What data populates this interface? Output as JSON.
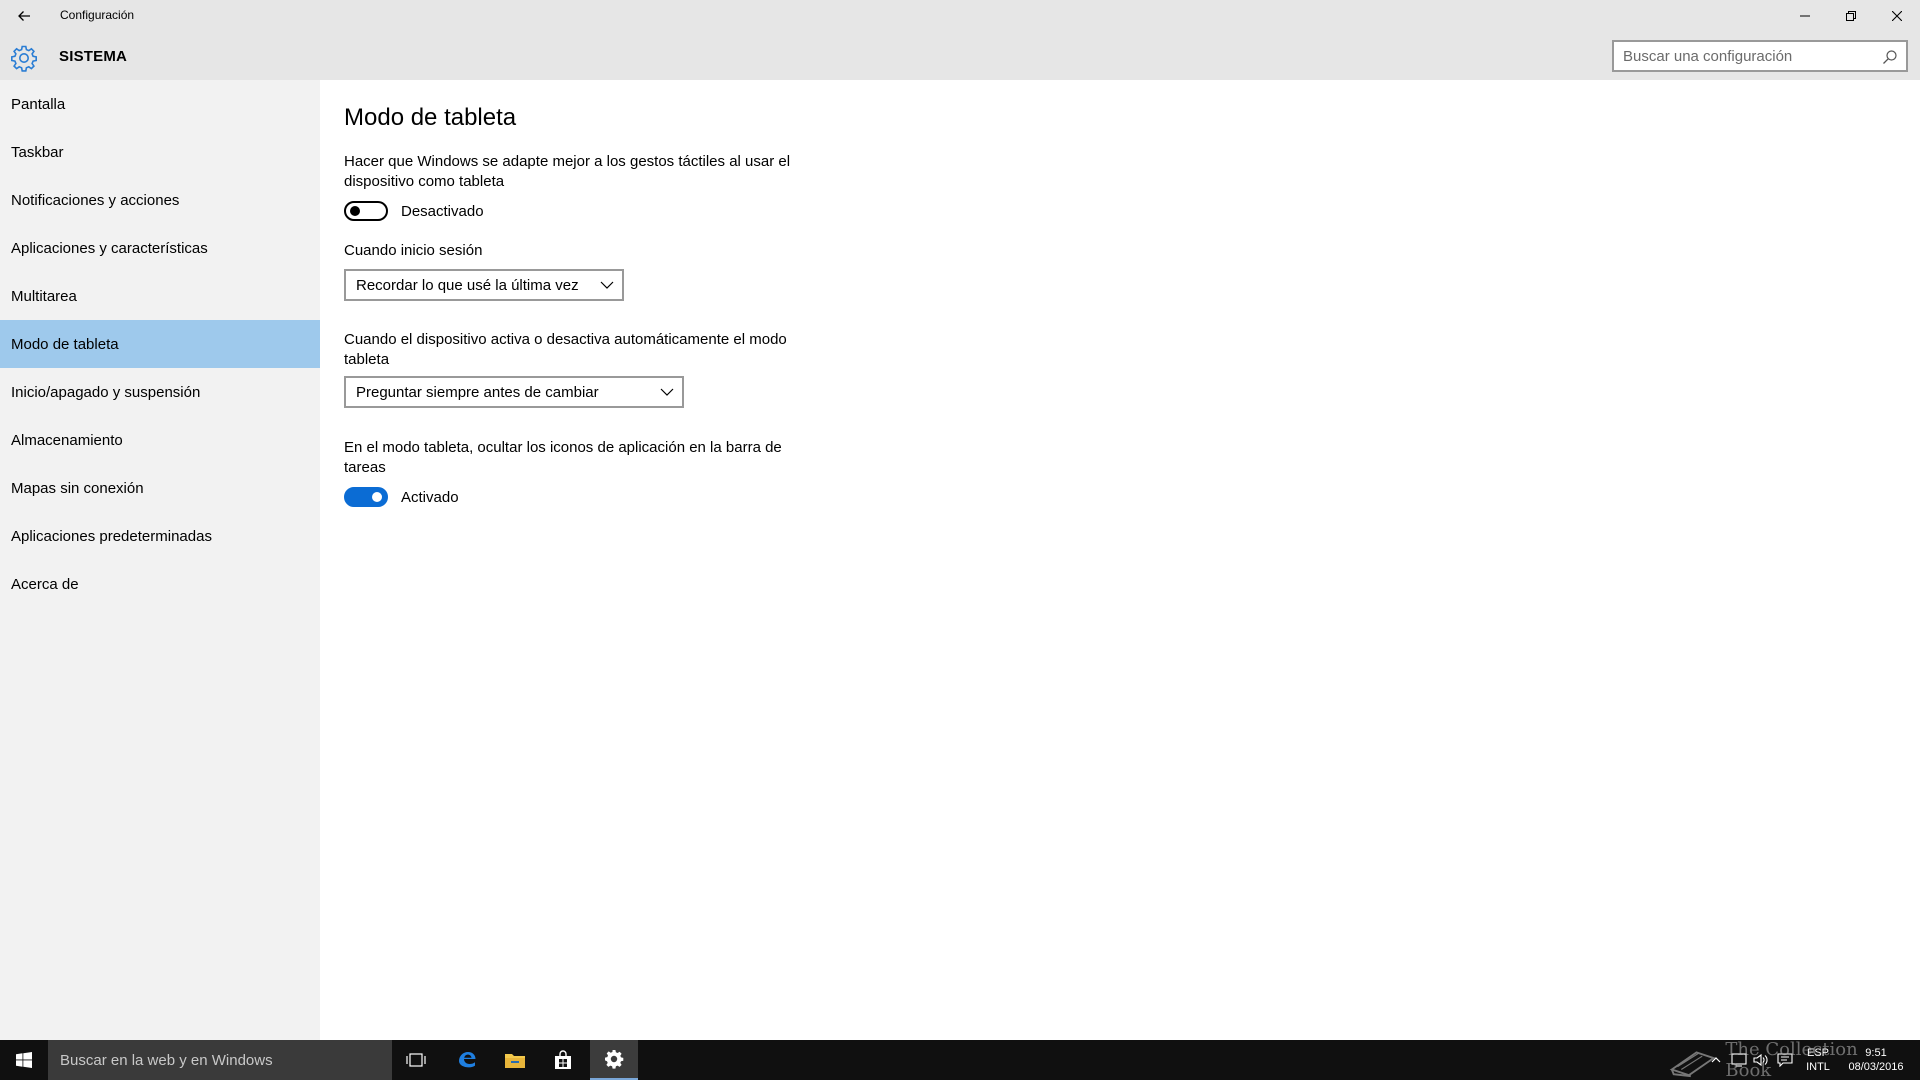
{
  "window": {
    "title": "Configuración"
  },
  "header": {
    "section_title": "SISTEMA",
    "search_placeholder": "Buscar una configuración"
  },
  "sidebar": {
    "items": [
      {
        "label": "Pantalla"
      },
      {
        "label": "Taskbar"
      },
      {
        "label": "Notificaciones y acciones"
      },
      {
        "label": "Aplicaciones y características"
      },
      {
        "label": "Multitarea"
      },
      {
        "label": "Modo de tableta",
        "selected": true
      },
      {
        "label": "Inicio/apagado y suspensión"
      },
      {
        "label": "Almacenamiento"
      },
      {
        "label": "Mapas sin conexión"
      },
      {
        "label": "Aplicaciones predeterminadas"
      },
      {
        "label": "Acerca de"
      }
    ]
  },
  "main": {
    "title": "Modo de tableta",
    "tablet_desc": "Hacer que Windows se adapte mejor a los gestos táctiles al usar el dispositivo como tableta",
    "tablet_toggle": {
      "state": "off",
      "label": "Desactivado"
    },
    "signin_label": "Cuando inicio sesión",
    "signin_value": "Recordar lo que usé la última vez",
    "auto_label": "Cuando el dispositivo activa o desactiva automáticamente el modo tableta",
    "auto_value": "Preguntar siempre antes de cambiar",
    "hide_icons_desc": "En el modo tableta, ocultar los iconos de aplicación en la barra de tareas",
    "hide_icons_toggle": {
      "state": "on",
      "label": "Activado"
    }
  },
  "taskbar": {
    "search_text": "Buscar en la web y en Windows",
    "lang_top": "ESP",
    "lang_bottom": "INTL",
    "time": "9:51",
    "date": "08/03/2016"
  },
  "watermark": {
    "text": "The Collection Book"
  },
  "colors": {
    "accent": "#0b6cd4",
    "selected_nav": "#9ec9ec",
    "sidebar_bg": "#f2f2f2",
    "header_bg": "#e6e6e6",
    "taskbar_bg": "#101010"
  }
}
